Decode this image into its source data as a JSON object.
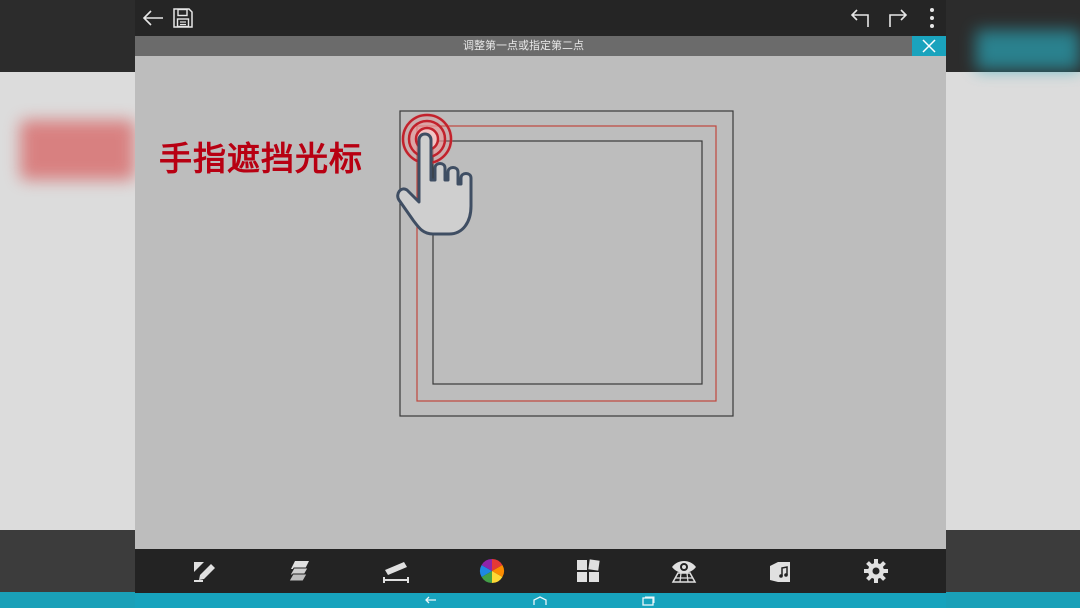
{
  "toolbar": {
    "back_icon": "arrow-left-icon",
    "save_icon": "save-icon",
    "undo_icon": "undo-icon",
    "redo_icon": "redo-icon",
    "more_icon": "more-vertical-icon"
  },
  "hint": {
    "text": "调整第一点或指定第二点",
    "close_icon": "close-icon"
  },
  "annotation": {
    "text": "手指遮挡光标",
    "color": "#b80012"
  },
  "bottom_tools": [
    "draw-pencil-icon",
    "layers-icon",
    "measure-ruler-icon",
    "color-wheel-icon",
    "blocks-icon",
    "view-eye-icon",
    "library-icon",
    "settings-gear-icon"
  ],
  "colors": {
    "accent": "#1aa3bd",
    "topbar": "#252525",
    "canvas": "#bdbdbd",
    "red_outline": "#c0463e"
  }
}
